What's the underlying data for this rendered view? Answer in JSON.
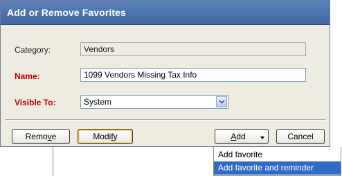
{
  "dialog": {
    "title": "Add or Remove  Favorites"
  },
  "form": {
    "category": {
      "label": "Category:",
      "value": "Vendors"
    },
    "name": {
      "label": "Name:",
      "value": "1099 Vendors Missing Tax Info"
    },
    "visible_to": {
      "label": "Visible To:",
      "value": "System"
    }
  },
  "buttons": {
    "remove": {
      "pre": "Remo",
      "accel": "v",
      "post": "e"
    },
    "modify": {
      "pre": "Modi",
      "accel": "f",
      "post": "y"
    },
    "add": {
      "pre": "",
      "accel": "A",
      "post": "dd"
    },
    "cancel": "Cancel"
  },
  "add_menu": {
    "items": [
      {
        "label": "Add favorite",
        "highlighted": false
      },
      {
        "label": "Add favorite and reminder",
        "highlighted": true
      }
    ]
  },
  "colors": {
    "title_bar": "#4a72ad",
    "required_label": "#c00000",
    "menu_highlight": "#316ac5",
    "dialog_background": "#eeece1"
  }
}
